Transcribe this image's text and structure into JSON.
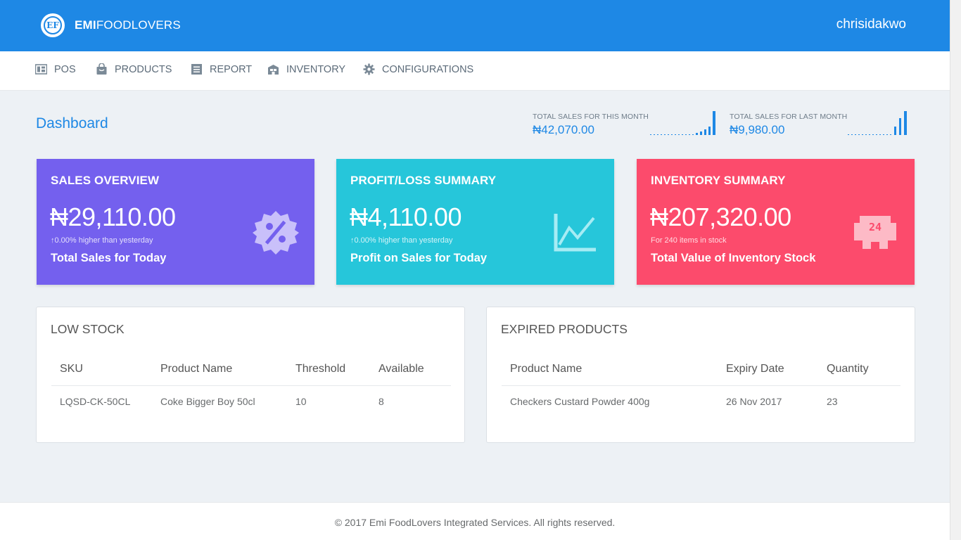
{
  "header": {
    "logo_mark": "EF",
    "brand_bold": "EMI",
    "brand_rest": "FOODLOVERS",
    "username": "chrisidakwo",
    "color": "#1e88e5"
  },
  "nav": {
    "items": [
      {
        "label": "POS",
        "icon": "cash-register-icon"
      },
      {
        "label": "PRODUCTS",
        "icon": "shopping-bag-icon"
      },
      {
        "label": "REPORT",
        "icon": "list-icon"
      },
      {
        "label": "INVENTORY",
        "icon": "warehouse-icon"
      },
      {
        "label": "CONFIGURATIONS",
        "icon": "gear-icon"
      }
    ]
  },
  "dashboard": {
    "title": "Dashboard",
    "this_month": {
      "label": "TOTAL SALES FOR THIS MONTH",
      "value": "₦42,070.00"
    },
    "last_month": {
      "label": "TOTAL SALES FOR LAST MONTH",
      "value": "₦9,980.00"
    }
  },
  "cards": {
    "sales": {
      "title": "SALES OVERVIEW",
      "value": "₦29,110.00",
      "sub": "0.00% higher than yesterday",
      "foot": "Total Sales for Today",
      "color": "#7460ee",
      "icon": "discount-badge-icon"
    },
    "profit": {
      "title": "PROFIT/LOSS SUMMARY",
      "value": "₦4,110.00",
      "sub": "0.00% higher than yesterday",
      "foot": "Profit on Sales for Today",
      "color": "#26c6da",
      "icon": "line-chart-icon"
    },
    "inventory": {
      "title": "INVENTORY SUMMARY",
      "value": "₦207,320.00",
      "sub": "For 240 items in stock",
      "foot": "Total Value of Inventory Stock",
      "color": "#fc4b6c",
      "icon": "store-24-icon",
      "icon_text": "24"
    }
  },
  "low_stock": {
    "title": "LOW STOCK",
    "headers": [
      "SKU",
      "Product Name",
      "Threshold",
      "Available"
    ],
    "rows": [
      [
        "LQSD-CK-50CL",
        "Coke Bigger Boy 50cl",
        "10",
        "8"
      ]
    ]
  },
  "expired": {
    "title": "EXPIRED PRODUCTS",
    "headers": [
      "Product Name",
      "Expiry Date",
      "Quantity"
    ],
    "rows": [
      [
        "Checkers Custard Powder 400g",
        "26 Nov 2017",
        "23"
      ]
    ]
  },
  "footer": {
    "text": "© 2017 Emi FoodLovers Integrated Services. All rights reserved."
  }
}
